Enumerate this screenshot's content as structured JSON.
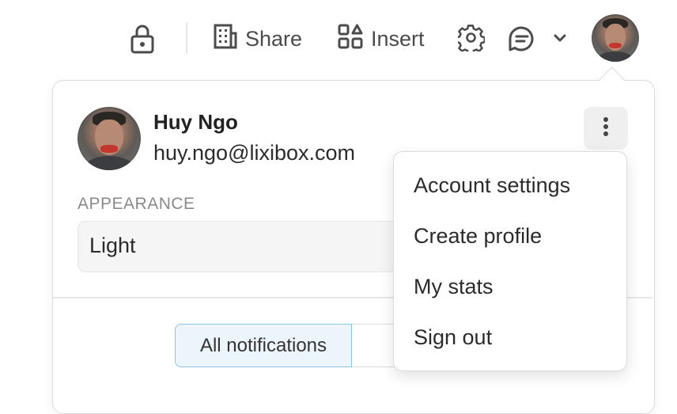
{
  "toolbar": {
    "lock_icon": "lock-icon",
    "share_label": "Share",
    "share_icon": "building-icon",
    "insert_label": "Insert",
    "insert_icon": "grid-shapes-icon",
    "settings_icon": "gear-icon",
    "comments_icon": "comment-icon",
    "dropdown_icon": "chevron-down-icon",
    "avatar_icon": "user-avatar"
  },
  "profile": {
    "name": "Huy Ngo",
    "email": "huy.ngo@lixibox.com",
    "more_icon": "kebab-icon"
  },
  "appearance": {
    "label": "APPEARANCE",
    "value": "Light"
  },
  "notifications": {
    "active_tab": "All notifications"
  },
  "menu": {
    "items": [
      "Account settings",
      "Create profile",
      "My stats",
      "Sign out"
    ]
  },
  "colors": {
    "icon": "#4b4b4b",
    "active_tab_border": "#8fc3e6",
    "active_tab_bg": "#ecf5fb"
  }
}
